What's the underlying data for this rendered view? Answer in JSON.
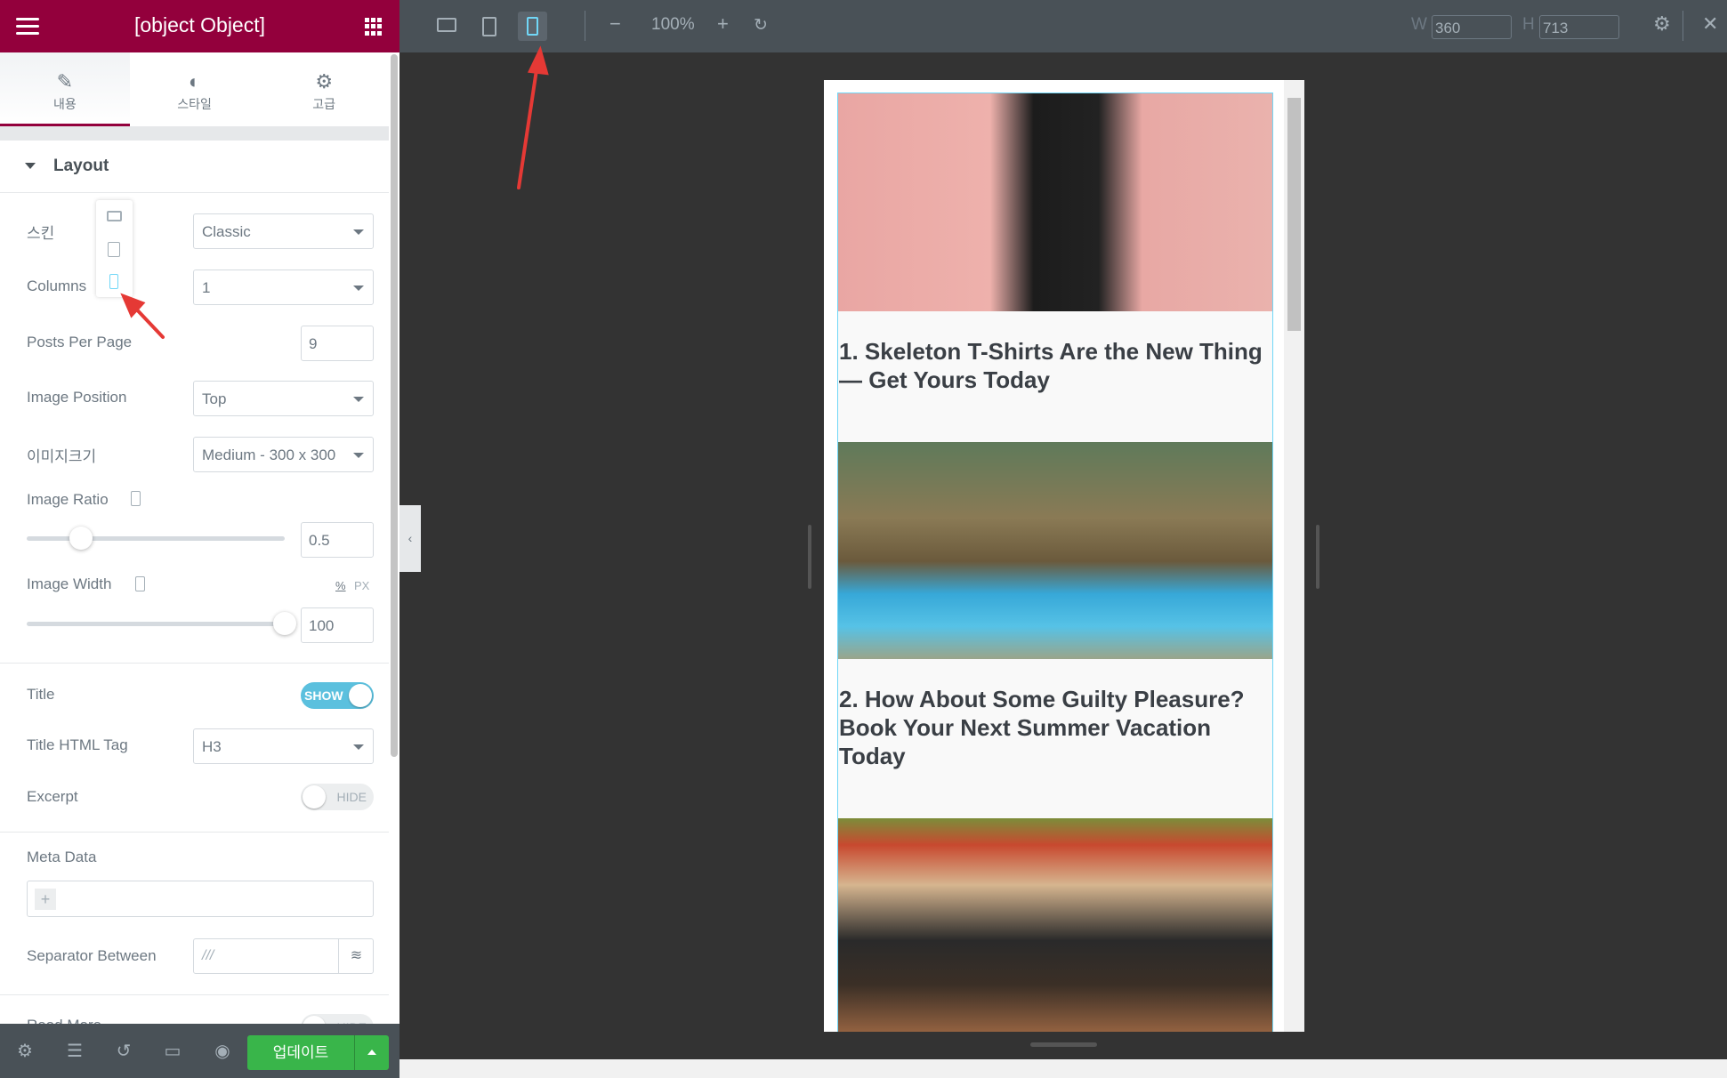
{
  "sidebar": {
    "title": {
      "label": "Title",
      "state": "SHOW"
    },
    "tabs": [
      {
        "label": "내용",
        "icon": "pencil-icon"
      },
      {
        "label": "스타일",
        "icon": "half-circle-icon"
      },
      {
        "label": "고급",
        "icon": "gear-icon"
      }
    ],
    "section": "Layout",
    "skin": {
      "label": "스킨",
      "value": "Classic"
    },
    "columns": {
      "label": "Columns",
      "value": "1"
    },
    "posts_per_page": {
      "label": "Posts Per Page",
      "value": "9"
    },
    "image_position": {
      "label": "Image Position",
      "value": "Top"
    },
    "image_size": {
      "label": "이미지크기",
      "value": "Medium - 300 x 300"
    },
    "image_ratio": {
      "label": "Image Ratio",
      "value": "0.5"
    },
    "image_width": {
      "label": "Image Width",
      "value": "100",
      "unit_pct": "%",
      "unit_px": "PX"
    },
    "title_tag": {
      "label": "Title HTML Tag",
      "value": "H3"
    },
    "excerpt": {
      "label": "Excerpt",
      "state": "HIDE"
    },
    "meta": {
      "label": "Meta Data",
      "add": "+"
    },
    "separator": {
      "label": "Separator Between",
      "value": "///"
    },
    "read_more": {
      "label": "Read More",
      "state": "HIDE"
    },
    "update_label": "업데이트"
  },
  "topbar": {
    "zoom": "100%",
    "w_label": "W",
    "w": "360",
    "h_label": "H",
    "h": "713",
    "active_device": "mobile"
  },
  "posts": [
    {
      "title": "1. Skeleton T-Shirts Are the New Thing — Get Yours Today"
    },
    {
      "title": "2. How About Some Guilty Pleasure? Book Your Next Summer Vacation Today"
    },
    {
      "title": ""
    }
  ],
  "colors": {
    "brand": "#93003c",
    "accent": "#71d7f7",
    "update": "#39b54a"
  }
}
